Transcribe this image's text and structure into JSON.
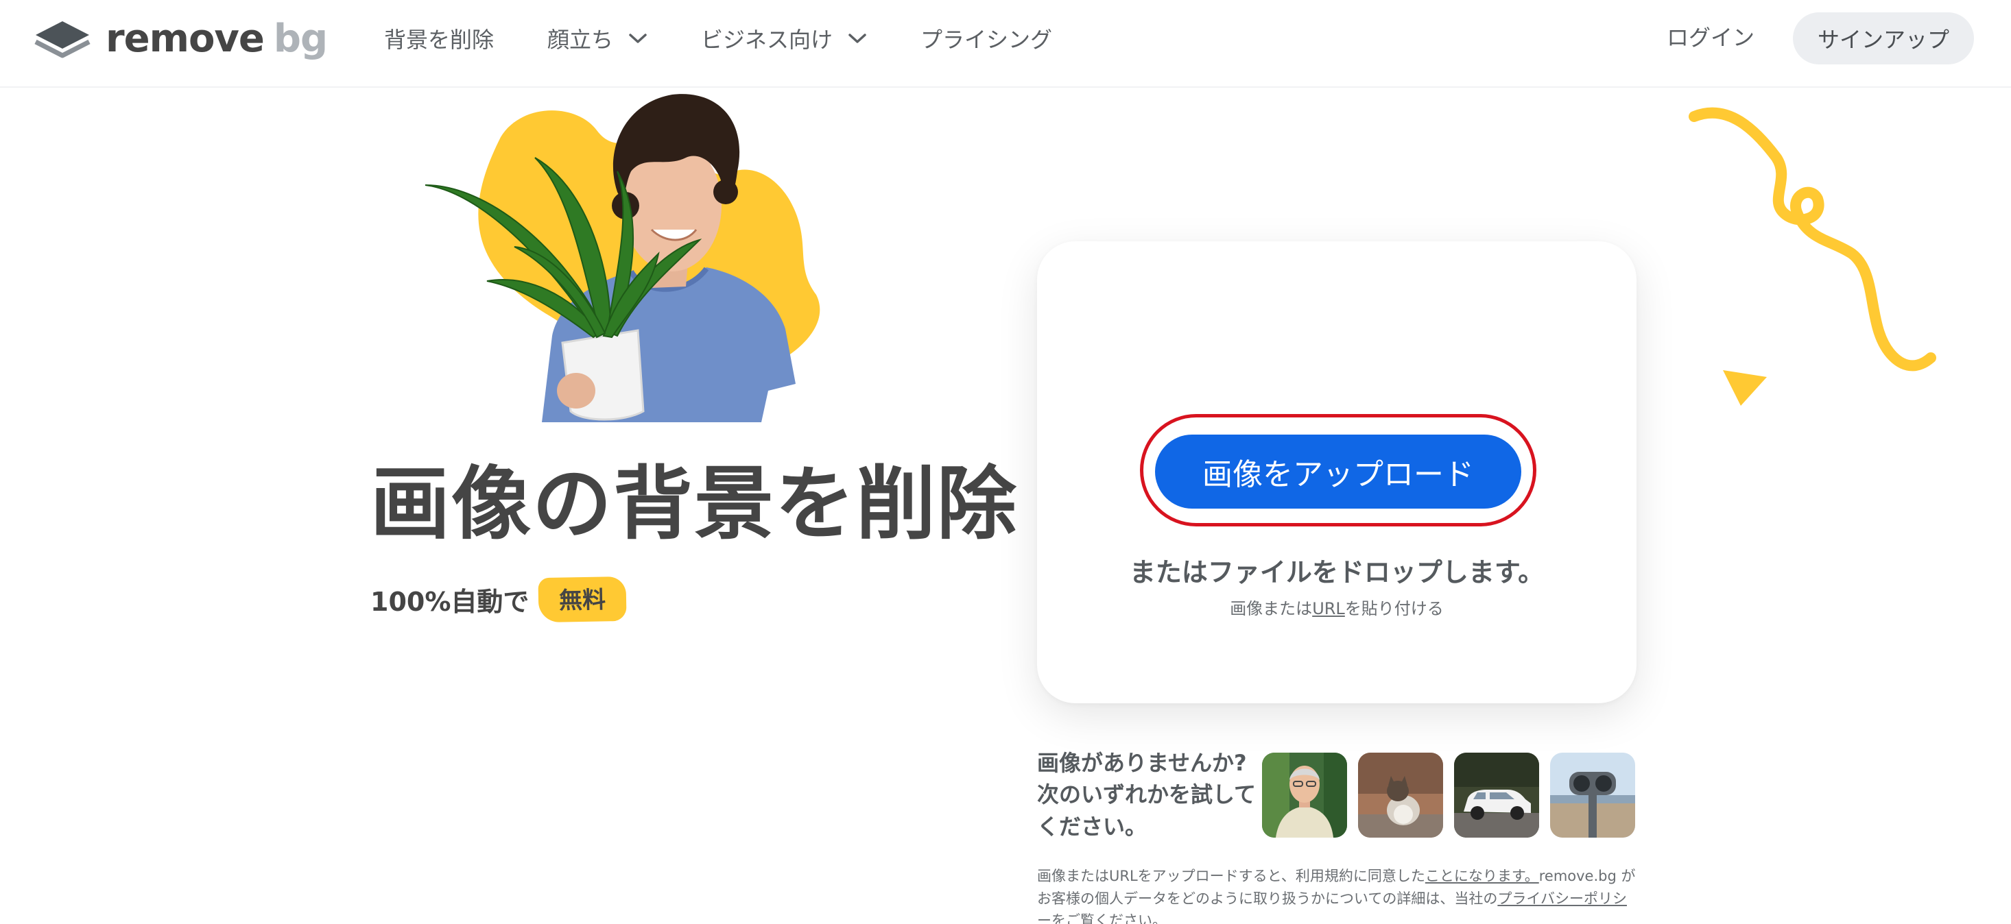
{
  "header": {
    "logo": {
      "word1": "remove",
      "word2": "bg"
    },
    "nav": [
      {
        "label": "背景を削除",
        "has_dropdown": false
      },
      {
        "label": "顔立ち",
        "has_dropdown": true
      },
      {
        "label": "ビジネス向け",
        "has_dropdown": true
      },
      {
        "label": "プライシング",
        "has_dropdown": false
      }
    ],
    "login_label": "ログイン",
    "signup_label": "サインアップ"
  },
  "hero": {
    "title": "画像の背景を削除",
    "subtitle_prefix": "100%自動で",
    "free_badge": "無料"
  },
  "upload": {
    "button_label": "画像をアップロード",
    "drop_text": "またはファイルをドロップします。",
    "paste_prefix": "画像または",
    "paste_link": "URL",
    "paste_suffix": "を貼り付ける"
  },
  "samples": {
    "prompt_line1": "画像がありませんか?",
    "prompt_line2": "次のいずれかを試して",
    "prompt_line3": "ください。",
    "thumbnails": [
      "person-photo",
      "cat-photo",
      "car-photo",
      "binoculars-photo"
    ]
  },
  "legal": {
    "part1": "画像またはURLをアップロードすると、利用規約に同意した",
    "link1": "ことになります。",
    "part2": "remove.bg がお客様の個人データをどのように取り扱うかについての詳細は、当社の",
    "link2": "プライバシーポリシー",
    "part3": "をご覧ください。"
  },
  "colors": {
    "primary_blue": "#1067e6",
    "accent_yellow": "#ffc933",
    "highlight_red": "#d8131f",
    "text_dark": "#454545"
  }
}
